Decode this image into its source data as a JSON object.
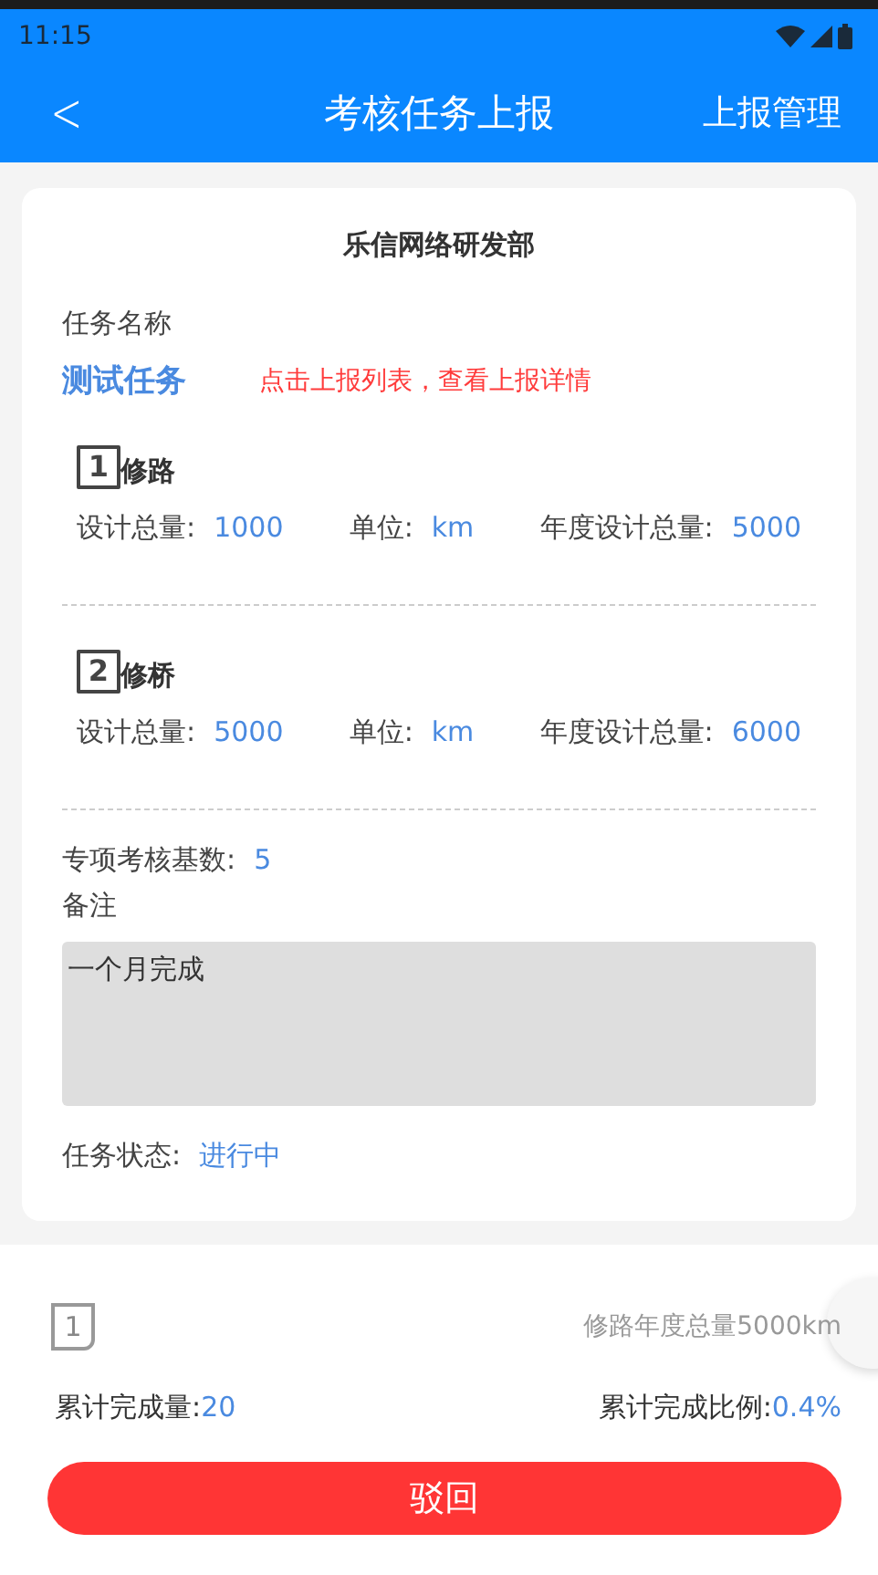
{
  "status_bar": {
    "time": "11:15"
  },
  "header": {
    "back": "<",
    "title": "考核任务上报",
    "action": "上报管理"
  },
  "card": {
    "org": "乐信网络研发部",
    "task_label": "任务名称",
    "task_name": "测试任务",
    "hint": "点击上报列表，查看上报详情",
    "items": [
      {
        "number": "1",
        "name": "修路",
        "fields": [
          {
            "label": "设计总量:",
            "value": "1000"
          },
          {
            "label": "单位:",
            "value": "km"
          },
          {
            "label": "年度设计总量:",
            "value": "5000"
          }
        ]
      },
      {
        "number": "2",
        "name": "修桥",
        "fields": [
          {
            "label": "设计总量:",
            "value": "5000"
          },
          {
            "label": "单位:",
            "value": "km"
          },
          {
            "label": "年度设计总量:",
            "value": "6000"
          }
        ]
      }
    ],
    "base_label": "专项考核基数:",
    "base_value": "5",
    "remark_label": "备注",
    "remark": "一个月完成",
    "status_label": "任务状态:",
    "status_value": "进行中"
  },
  "summary": {
    "number": "1",
    "annual_total": "修路年度总量5000km",
    "done_label": "累计完成量:",
    "done_value": "20",
    "ratio_label": "累计完成比例:",
    "ratio_value": "0.4%"
  },
  "reject_button": "驳回"
}
